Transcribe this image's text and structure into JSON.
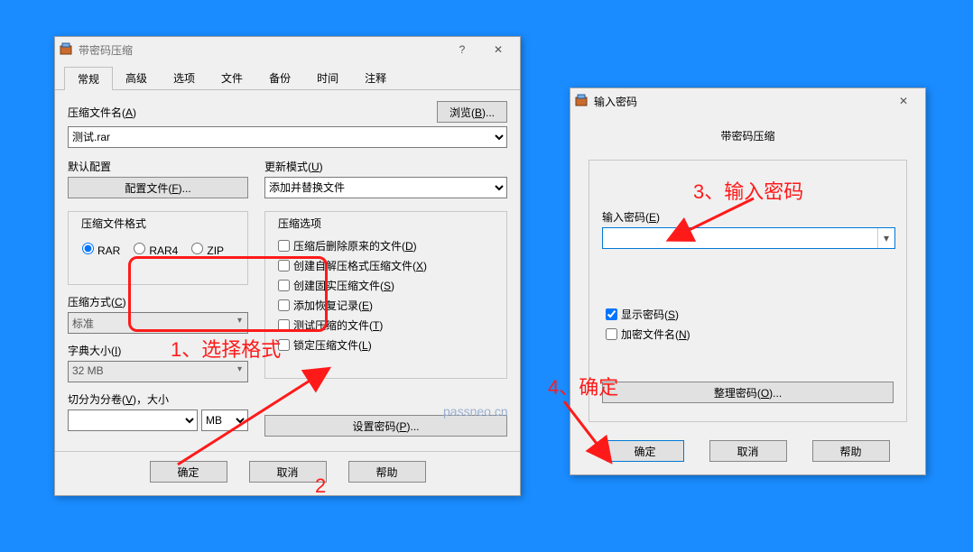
{
  "main": {
    "title": "带密码压缩",
    "tabs": [
      "常规",
      "高级",
      "选项",
      "文件",
      "备份",
      "时间",
      "注释"
    ],
    "filename_label": "压缩文件名(",
    "filename_key": "A",
    "filename_label2": ")",
    "filename_value": "测试.rar",
    "browse": "浏览(",
    "browse_key": "B",
    "browse2": ")...",
    "default_profile": "默认配置",
    "profile_btn": "配置文件(",
    "profile_key": "F",
    "profile_btn2": ")...",
    "update_mode_lbl": "更新模式(",
    "update_mode_key": "U",
    "update_mode_lbl2": ")",
    "update_mode_val": "添加并替换文件",
    "format_legend": "压缩文件格式",
    "fmt_rar": "RAR",
    "fmt_rar4": "RAR4",
    "fmt_zip": "ZIP",
    "opt_legend": "压缩选项",
    "opt1": "压缩后删除原来的文件(",
    "opt1k": "D",
    "opt2": "创建自解压格式压缩文件(",
    "opt2k": "X",
    "opt3": "创建固实压缩文件(",
    "opt3k": "S",
    "opt4": "添加恢复记录(",
    "opt4k": "E",
    "opt5": "测试压缩的文件(",
    "opt5k": "T",
    "opt6": "锁定压缩文件(",
    "opt6k": "L",
    "close_paren": ")",
    "method_lbl": "压缩方式(",
    "method_key": "C",
    "method_val": "标准",
    "dict_lbl": "字典大小(",
    "dict_key": "I",
    "dict_val": "32 MB",
    "split_lbl": "切分为分卷(",
    "split_key": "V",
    "split_lbl2": ")，大小",
    "split_unit": "MB",
    "set_pw": "设置密码(",
    "set_pw_key": "P",
    "set_pw2": ")...",
    "ok": "确定",
    "cancel": "取消",
    "help": "帮助"
  },
  "pw": {
    "title": "输入密码",
    "subtitle": "带密码压缩",
    "enter_pw": "输入密码(",
    "enter_pw_key": "E",
    "show_pw": "显示密码(",
    "show_pw_key": "S",
    "enc_names": "加密文件名(",
    "enc_names_key": "N",
    "organize": "整理密码(",
    "organize_key": "O",
    "organize2": ")...",
    "ok": "确定",
    "cancel": "取消",
    "help": "帮助",
    "close_paren": ")"
  },
  "annots": {
    "a1": "1、选择格式",
    "a2": "2",
    "a3": "3、输入密码",
    "a4": "4、确定"
  },
  "watermark": "passneo.cn"
}
